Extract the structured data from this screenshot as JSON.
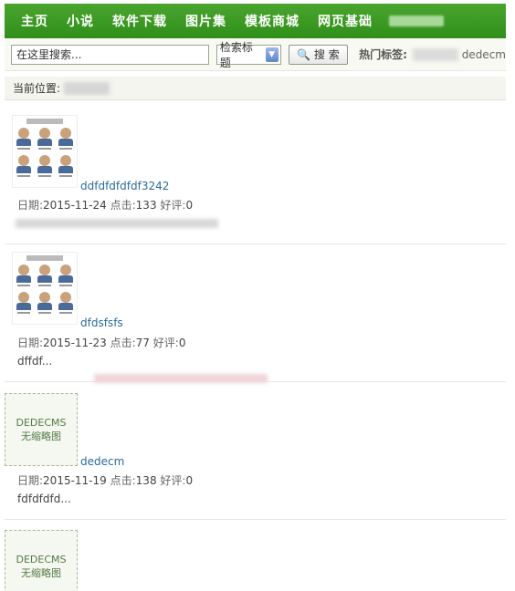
{
  "nav": {
    "items": [
      "主页",
      "小说",
      "软件下载",
      "图片集",
      "模板商城",
      "网页基础"
    ]
  },
  "search": {
    "placeholder": "在这里搜索...",
    "select_value": "检索标题",
    "button_label": "搜 索",
    "hot_label": "热门标签:",
    "hot_tag": "dedecm"
  },
  "breadcrumb": {
    "label": "当前位置:"
  },
  "articles": [
    {
      "title": "ddfdfdfdfdf3242",
      "date_label": "日期:",
      "date": "2015-11-24",
      "clicks_label": "点击:",
      "clicks": "133",
      "rating_label": "好评:",
      "rating": "0",
      "desc": "",
      "thumb": "image"
    },
    {
      "title": "dfdsfsfs",
      "date_label": "日期:",
      "date": "2015-11-23",
      "clicks_label": "点击:",
      "clicks": "77",
      "rating_label": "好评:",
      "rating": "0",
      "desc": "dffdf...",
      "thumb": "image"
    },
    {
      "title": "dedecm",
      "date_label": "日期:",
      "date": "2015-11-19",
      "clicks_label": "点击:",
      "clicks": "138",
      "rating_label": "好评:",
      "rating": "0",
      "desc": "fdfdfdfd...",
      "thumb": "none",
      "thumb_line1": "DEDECMS",
      "thumb_line2": "无缩略图"
    },
    {
      "title": "",
      "thumb": "none",
      "thumb_line1": "DEDECMS",
      "thumb_line2": "无缩略图"
    }
  ]
}
